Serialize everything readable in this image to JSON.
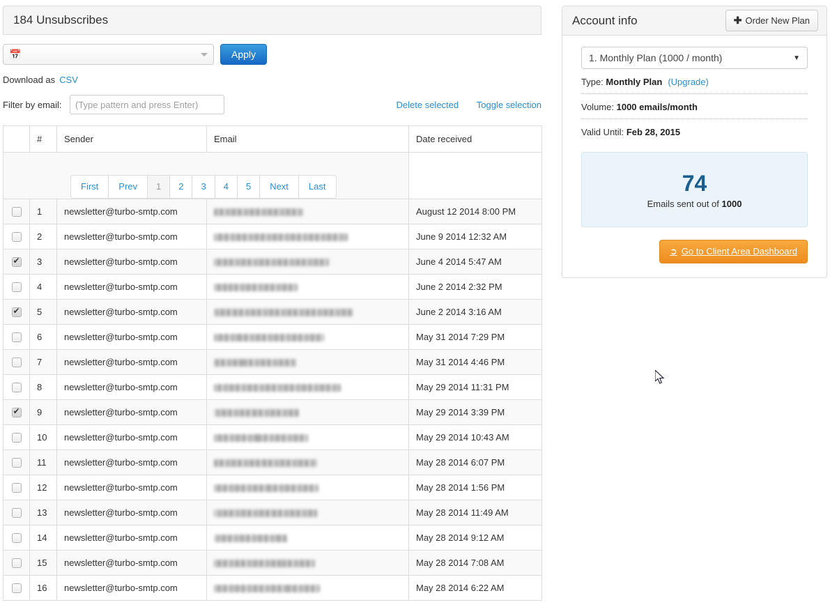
{
  "left": {
    "heading": "184 Unsubscribes",
    "date_filter": {
      "icon": "calendar-icon",
      "value": "",
      "caret": "chevron-down-icon"
    },
    "apply_label": "Apply",
    "download_text": "Download as",
    "download_link": "CSV",
    "filter_label": "Filter by email:",
    "filter_value": "",
    "filter_placeholder": "(Type pattern and press Enter)",
    "delete_selected_label": "Delete selected",
    "toggle_selection_label": "Toggle selection",
    "columns": [
      "",
      "#",
      "Sender",
      "Email",
      "Date received"
    ],
    "pagination": {
      "first": "First",
      "prev": "Prev",
      "pages": [
        "1",
        "2",
        "3",
        "4",
        "5"
      ],
      "active_page": "1",
      "next": "Next",
      "last": "Last"
    },
    "rows": [
      {
        "num": "1",
        "checked": false,
        "sender": "newsletter@turbo-smtp.com",
        "email_redacted_width": 128,
        "date": "August 12 2014 8:00 PM"
      },
      {
        "num": "2",
        "checked": false,
        "sender": "newsletter@turbo-smtp.com",
        "email_redacted_width": 192,
        "date": "June 9 2014 12:32 AM"
      },
      {
        "num": "3",
        "checked": true,
        "sender": "newsletter@turbo-smtp.com",
        "email_redacted_width": 165,
        "date": "June 4 2014 5:47 AM"
      },
      {
        "num": "4",
        "checked": false,
        "sender": "newsletter@turbo-smtp.com",
        "email_redacted_width": 120,
        "date": "June 2 2014 2:32 PM"
      },
      {
        "num": "5",
        "checked": true,
        "sender": "newsletter@turbo-smtp.com",
        "email_redacted_width": 200,
        "date": "June 2 2014 3:16 AM"
      },
      {
        "num": "6",
        "checked": false,
        "sender": "newsletter@turbo-smtp.com",
        "email_redacted_width": 158,
        "date": "May 31 2014 7:29 PM"
      },
      {
        "num": "7",
        "checked": false,
        "sender": "newsletter@turbo-smtp.com",
        "email_redacted_width": 118,
        "date": "May 31 2014 4:46 PM"
      },
      {
        "num": "8",
        "checked": false,
        "sender": "newsletter@turbo-smtp.com",
        "email_redacted_width": 182,
        "date": "May 29 2014 11:31 PM"
      },
      {
        "num": "9",
        "checked": true,
        "sender": "newsletter@turbo-smtp.com",
        "email_redacted_width": 122,
        "date": "May 29 2014 3:39 PM"
      },
      {
        "num": "10",
        "checked": false,
        "sender": "newsletter@turbo-smtp.com",
        "email_redacted_width": 135,
        "date": "May 29 2014 10:43 AM"
      },
      {
        "num": "11",
        "checked": false,
        "sender": "newsletter@turbo-smtp.com",
        "email_redacted_width": 148,
        "date": "May 28 2014 6:07 PM"
      },
      {
        "num": "12",
        "checked": false,
        "sender": "newsletter@turbo-smtp.com",
        "email_redacted_width": 150,
        "date": "May 28 2014 1:56 PM"
      },
      {
        "num": "13",
        "checked": false,
        "sender": "newsletter@turbo-smtp.com",
        "email_redacted_width": 148,
        "date": "May 28 2014 11:49 AM"
      },
      {
        "num": "14",
        "checked": false,
        "sender": "newsletter@turbo-smtp.com",
        "email_redacted_width": 105,
        "date": "May 28 2014 9:12 AM"
      },
      {
        "num": "15",
        "checked": false,
        "sender": "newsletter@turbo-smtp.com",
        "email_redacted_width": 145,
        "date": "May 28 2014 7:08 AM"
      },
      {
        "num": "16",
        "checked": false,
        "sender": "newsletter@turbo-smtp.com",
        "email_redacted_width": 152,
        "date": "May 28 2014 6:22 AM"
      }
    ]
  },
  "right": {
    "title": "Account info",
    "order_plan_label": "Order New Plan",
    "plan_select_value": "1. Monthly Plan (1000 / month)",
    "type_label": "Type:",
    "type_value": "Monthly Plan",
    "upgrade_link": "(Upgrade)",
    "volume_label": "Volume:",
    "volume_value": "1000 emails/month",
    "valid_label": "Valid Until:",
    "valid_value": "Feb 28, 2015",
    "stat_number": "74",
    "stat_prefix": "Emails sent out of",
    "stat_total": "1000",
    "dashboard_label": "Go to Client Area Dashboard"
  },
  "colors": {
    "link": "#2a8fd4",
    "apply_button": "#1668c4",
    "orange_button": "#ee8c1f",
    "stat_blue": "#1b5f8e",
    "panel_header_bg": "#f5f5f5",
    "border": "#dddddd"
  }
}
